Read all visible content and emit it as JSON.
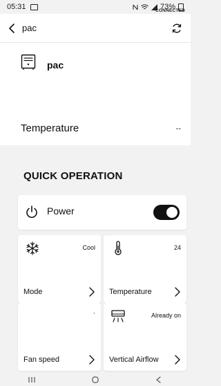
{
  "status_bar": {
    "time": "05:31",
    "battery": "73%"
  },
  "header": {
    "title": "pac"
  },
  "device": {
    "connection_status": "CONNECTED",
    "name": "pac",
    "temperature_label": "Temperature",
    "temperature_value": "--"
  },
  "quick_operation": {
    "title": "QUICK OPERATION",
    "power_label": "Power",
    "power_on": true
  },
  "tiles": [
    {
      "label": "Mode",
      "value": "Cool"
    },
    {
      "label": "Temperature",
      "value": "24"
    },
    {
      "label": "Fan speed",
      "value": "`"
    },
    {
      "label": "Vertical Airflow",
      "value": "Already on"
    }
  ],
  "colors": {
    "toggle_on": "#111111",
    "background": "#f2f2f2",
    "card": "#ffffff"
  }
}
